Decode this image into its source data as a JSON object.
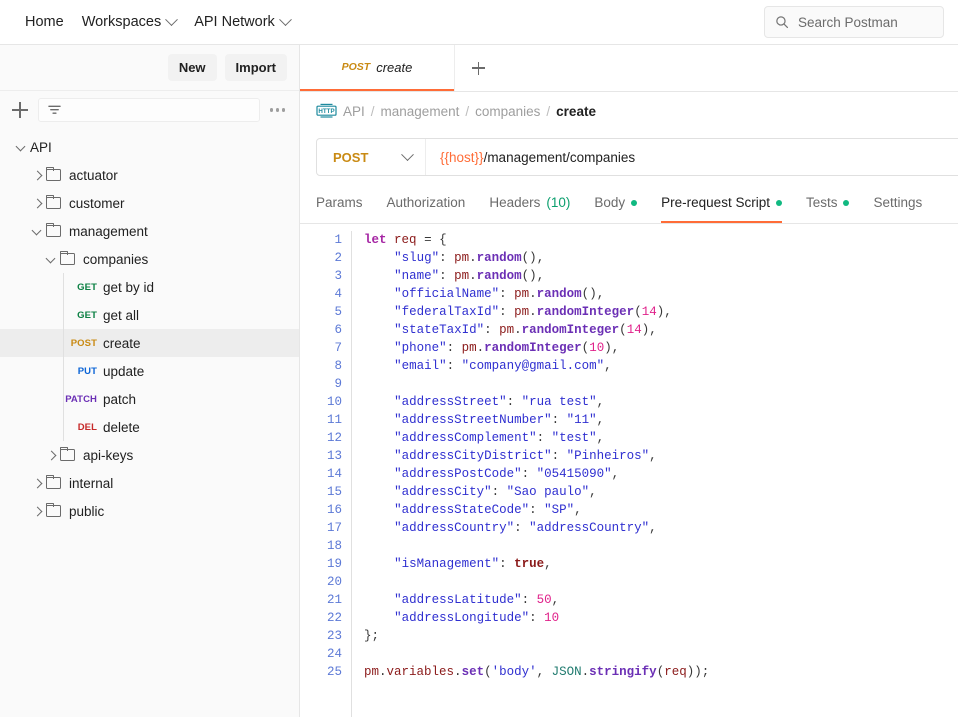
{
  "topbar": {
    "nav": [
      {
        "label": "Home",
        "has_caret": false
      },
      {
        "label": "Workspaces",
        "has_caret": true
      },
      {
        "label": "API Network",
        "has_caret": true
      }
    ],
    "search": {
      "placeholder": "Search Postman",
      "value": "",
      "icon": "search-icon"
    }
  },
  "sidebar": {
    "actions": {
      "new_label": "New",
      "import_label": "Import"
    },
    "filter": {
      "placeholder": "",
      "value": "",
      "icon": "filter-icon"
    },
    "more_label": "More actions",
    "tree": [
      {
        "label": "API",
        "type": "collection",
        "depth": 0,
        "expanded": true,
        "selected": false
      },
      {
        "label": "actuator",
        "type": "folder",
        "depth": 1,
        "expanded": false,
        "selected": false
      },
      {
        "label": "customer",
        "type": "folder",
        "depth": 1,
        "expanded": false,
        "selected": false
      },
      {
        "label": "management",
        "type": "folder",
        "depth": 1,
        "expanded": true,
        "selected": false
      },
      {
        "label": "companies",
        "type": "folder",
        "depth": 2,
        "expanded": true,
        "selected": false
      },
      {
        "label": "get by id",
        "type": "request",
        "depth": 3,
        "method": "GET",
        "selected": false
      },
      {
        "label": "get all",
        "type": "request",
        "depth": 3,
        "method": "GET",
        "selected": false
      },
      {
        "label": "create",
        "type": "request",
        "depth": 3,
        "method": "POST",
        "selected": true
      },
      {
        "label": "update",
        "type": "request",
        "depth": 3,
        "method": "PUT",
        "selected": false
      },
      {
        "label": "patch",
        "type": "request",
        "depth": 3,
        "method": "PATCH",
        "selected": false
      },
      {
        "label": "delete",
        "type": "request",
        "depth": 3,
        "method": "DEL",
        "selected": false
      },
      {
        "label": "api-keys",
        "type": "folder",
        "depth": 2,
        "expanded": false,
        "selected": false
      },
      {
        "label": "internal",
        "type": "folder",
        "depth": 1,
        "expanded": false,
        "selected": false
      },
      {
        "label": "public",
        "type": "folder",
        "depth": 1,
        "expanded": false,
        "selected": false
      }
    ]
  },
  "method_colors": {
    "GET": "#0b8043",
    "POST": "#c98a13",
    "PUT": "#0b64d6",
    "PATCH": "#6b2fb5",
    "DEL": "#c62828"
  },
  "tabstrip": {
    "tabs": [
      {
        "method": "POST",
        "name": "create",
        "active": true
      }
    ],
    "add_label": "+"
  },
  "breadcrumb": {
    "icon": "http-icon",
    "items": [
      "API",
      "management",
      "companies",
      "create"
    ],
    "separator": "/"
  },
  "urlbar": {
    "method": "POST",
    "caret_icon": "chevron-down-icon",
    "url_prefix": "{{host}}",
    "url_rest": "/management/companies",
    "url_full": "{{host}}/management/companies"
  },
  "subtabs": [
    {
      "label": "Params",
      "active": false,
      "dot": false,
      "count": null
    },
    {
      "label": "Authorization",
      "active": false,
      "dot": false,
      "count": null
    },
    {
      "label": "Headers",
      "active": false,
      "dot": false,
      "count": "(10)"
    },
    {
      "label": "Body",
      "active": false,
      "dot": true,
      "count": null
    },
    {
      "label": "Pre-request Script",
      "active": true,
      "dot": true,
      "count": null
    },
    {
      "label": "Tests",
      "active": false,
      "dot": true,
      "count": null
    },
    {
      "label": "Settings",
      "active": false,
      "dot": false,
      "count": null
    }
  ],
  "editor": {
    "accent": "#ff6c37",
    "line_numbers": [
      1,
      2,
      3,
      4,
      5,
      6,
      7,
      8,
      9,
      10,
      11,
      12,
      13,
      14,
      15,
      16,
      17,
      18,
      19,
      20,
      21,
      22,
      23,
      24,
      25
    ],
    "lines": [
      "let req = {",
      "    \"slug\": pm.random(),",
      "    \"name\": pm.random(),",
      "    \"officialName\": pm.random(),",
      "    \"federalTaxId\": pm.randomInteger(14),",
      "    \"stateTaxId\": pm.randomInteger(14),",
      "    \"phone\": pm.randomInteger(10),",
      "    \"email\": \"company@gmail.com\",",
      "",
      "    \"addressStreet\": \"rua test\",",
      "    \"addressStreetNumber\": \"11\",",
      "    \"addressComplement\": \"test\",",
      "    \"addressCityDistrict\": \"Pinheiros\",",
      "    \"addressPostCode\": \"05415090\",",
      "    \"addressCity\": \"Sao paulo\",",
      "    \"addressStateCode\": \"SP\",",
      "    \"addressCountry\": \"addressCountry\",",
      "",
      "    \"isManagement\": true,",
      "",
      "    \"addressLatitude\": 50,",
      "    \"addressLongitude\": 10",
      "};",
      "",
      "pm.variables.set('body', JSON.stringify(req));"
    ]
  }
}
